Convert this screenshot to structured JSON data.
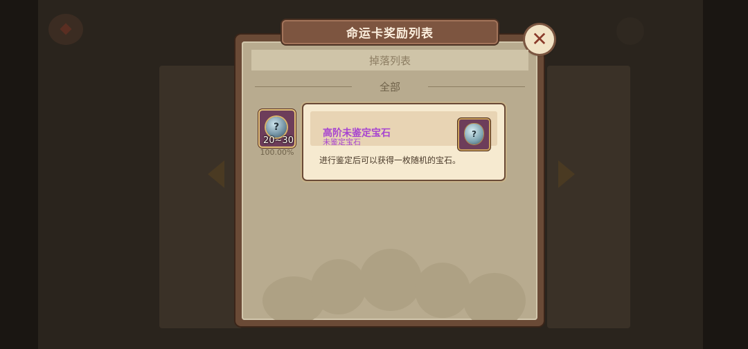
{
  "dialog": {
    "title": "命运卡奖励列表",
    "close_icon": "close-x-icon",
    "subheader": "掉落列表",
    "filter_label": "全部"
  },
  "reward": {
    "icon": "unidentified-gem-icon",
    "quantity": "20~30",
    "chance": "100.00%"
  },
  "tooltip": {
    "item_name": "高阶未鉴定宝石",
    "item_type": "未鉴定宝石",
    "item_icon": "unidentified-gem-icon",
    "description": "进行鉴定后可以获得一枚随机的宝石。"
  },
  "colors": {
    "item_name": "#a744d0",
    "dialog_frame": "#6a4a36",
    "dialog_body": "#b8ab8f",
    "tooltip_bg": "#f6ead0"
  }
}
